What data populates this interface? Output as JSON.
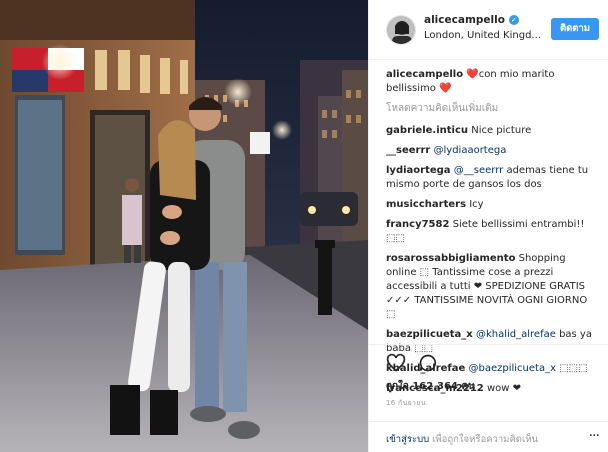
{
  "post": {
    "username": "alicecampello",
    "verified_icon": "verified-badge-icon",
    "location": "London, United Kingd...",
    "follow_label": "ติดตาม",
    "photo_desc": "couple-street-photo"
  },
  "caption": {
    "user": "alicecampello",
    "text": "❤️con mio marito bellissimo ❤️"
  },
  "load_more": "โหลดความคิดเห็นเพิ่มเติม",
  "comments": [
    {
      "user": "gabriele.inticu",
      "text": "Nice picture",
      "mention": ""
    },
    {
      "user": "__seerrr",
      "text": "",
      "mention": "@lydiaaortega"
    },
    {
      "user": "lydiaortega",
      "mention": "@__seerrr",
      "text": "ademas tiene tu mismo porte de gansos los dos"
    },
    {
      "user": "musiccharters",
      "text": "Icy",
      "mention": ""
    },
    {
      "user": "francy7582",
      "text": "Siete bellissimi entrambi!! ⬚⬚",
      "mention": ""
    },
    {
      "user": "rosarossabbigliamento",
      "text": "Shopping online ⬚ Tantissime cose a prezzi accessibili a tutti ❤ SPEDIZIONE GRATIS ✓✓✓ TANTISSIME NOVITÀ OGNI GIORNO ⬚",
      "mention": ""
    },
    {
      "user": "baezpilicueta_x",
      "mention": "@khalid_alrefae",
      "text": "bas ya baba ⬚⬚"
    },
    {
      "user": "khalid_alrefae",
      "mention": "@baezpilicueta_x",
      "text": "⬚⬚⬚"
    },
    {
      "user": "francesca_m2212",
      "text": "wow ❤",
      "mention": ""
    }
  ],
  "actions": {
    "like_icon": "heart-icon",
    "comment_icon": "comment-icon",
    "likes_label": "ถูกใจ 162,364 คน",
    "date": "16 กันยายน"
  },
  "login": {
    "link": "เข้าสู่ระบบ",
    "text": " เพื่อถูกใจหรือความคิดเห็น",
    "more": "···"
  }
}
